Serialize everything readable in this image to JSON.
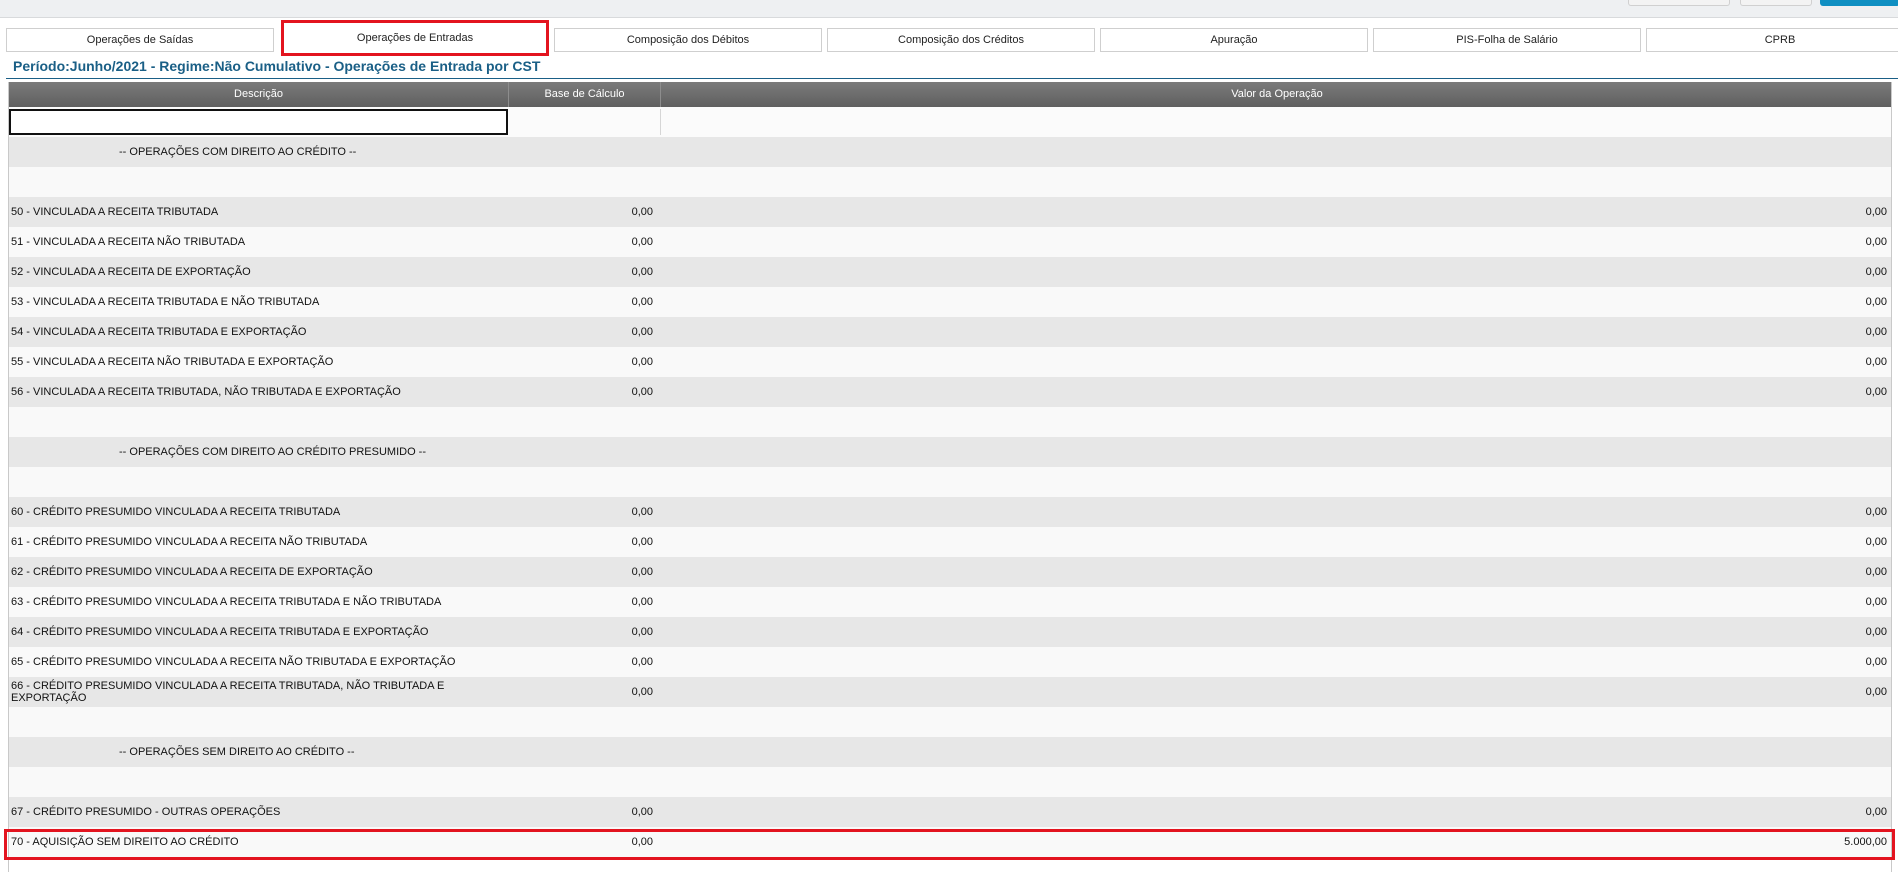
{
  "tabs": [
    {
      "label": "Operações de Saídas",
      "active": false
    },
    {
      "label": "Operações de Entradas",
      "active": true
    },
    {
      "label": "Composição dos Débitos",
      "active": false
    },
    {
      "label": "Composição dos Créditos",
      "active": false
    },
    {
      "label": "Apuração",
      "active": false
    },
    {
      "label": "PIS-Folha de Salário",
      "active": false
    },
    {
      "label": "CPRB",
      "active": false
    }
  ],
  "period_title": "Período:Junho/2021 - Regime:Não Cumulativo - Operações de Entrada por CST",
  "table": {
    "columns": [
      "Descrição",
      "Base de Cálculo",
      "Valor da Operação"
    ],
    "filter_value": "",
    "rows": [
      {
        "type": "section",
        "desc": "-- OPERAÇÕES COM DIREITO AO CRÉDITO --",
        "base": "",
        "valor": ""
      },
      {
        "type": "blank",
        "desc": "",
        "base": "",
        "valor": ""
      },
      {
        "type": "data",
        "desc": "50 - VINCULADA A RECEITA TRIBUTADA",
        "base": "0,00",
        "valor": "0,00"
      },
      {
        "type": "data",
        "desc": "51 - VINCULADA A RECEITA NÃO TRIBUTADA",
        "base": "0,00",
        "valor": "0,00"
      },
      {
        "type": "data",
        "desc": "52 - VINCULADA A RECEITA DE EXPORTAÇÃO",
        "base": "0,00",
        "valor": "0,00"
      },
      {
        "type": "data",
        "desc": "53 - VINCULADA A RECEITA TRIBUTADA E NÃO TRIBUTADA",
        "base": "0,00",
        "valor": "0,00"
      },
      {
        "type": "data",
        "desc": "54 - VINCULADA A RECEITA TRIBUTADA E EXPORTAÇÃO",
        "base": "0,00",
        "valor": "0,00"
      },
      {
        "type": "data",
        "desc": "55 - VINCULADA A RECEITA NÃO TRIBUTADA E EXPORTAÇÃO",
        "base": "0,00",
        "valor": "0,00"
      },
      {
        "type": "data",
        "desc": "56 - VINCULADA A RECEITA TRIBUTADA, NÃO TRIBUTADA E EXPORTAÇÃO",
        "base": "0,00",
        "valor": "0,00"
      },
      {
        "type": "blank",
        "desc": "",
        "base": "",
        "valor": ""
      },
      {
        "type": "section",
        "desc": "-- OPERAÇÕES COM DIREITO AO CRÉDITO PRESUMIDO --",
        "base": "",
        "valor": ""
      },
      {
        "type": "blank",
        "desc": "",
        "base": "",
        "valor": ""
      },
      {
        "type": "data",
        "desc": "60 - CRÉDITO PRESUMIDO VINCULADA A RECEITA TRIBUTADA",
        "base": "0,00",
        "valor": "0,00"
      },
      {
        "type": "data",
        "desc": "61 - CRÉDITO PRESUMIDO VINCULADA A RECEITA NÃO TRIBUTADA",
        "base": "0,00",
        "valor": "0,00"
      },
      {
        "type": "data",
        "desc": "62 - CRÉDITO PRESUMIDO VINCULADA A RECEITA DE EXPORTAÇÃO",
        "base": "0,00",
        "valor": "0,00"
      },
      {
        "type": "data",
        "desc": "63 - CRÉDITO PRESUMIDO VINCULADA A RECEITA TRIBUTADA E NÃO TRIBUTADA",
        "base": "0,00",
        "valor": "0,00"
      },
      {
        "type": "data",
        "desc": "64 - CRÉDITO PRESUMIDO VINCULADA A RECEITA TRIBUTADA E EXPORTAÇÃO",
        "base": "0,00",
        "valor": "0,00"
      },
      {
        "type": "data",
        "desc": "65 - CRÉDITO PRESUMIDO VINCULADA A RECEITA NÃO TRIBUTADA E EXPORTAÇÃO",
        "base": "0,00",
        "valor": "0,00"
      },
      {
        "type": "data",
        "desc": "66 - CRÉDITO PRESUMIDO VINCULADA A RECEITA TRIBUTADA, NÃO TRIBUTADA E EXPORTAÇÃO",
        "base": "0,00",
        "valor": "0,00"
      },
      {
        "type": "blank",
        "desc": "",
        "base": "",
        "valor": ""
      },
      {
        "type": "section",
        "desc": "-- OPERAÇÕES SEM DIREITO AO CRÉDITO --",
        "base": "",
        "valor": ""
      },
      {
        "type": "blank",
        "desc": "",
        "base": "",
        "valor": ""
      },
      {
        "type": "data",
        "desc": "67 - CRÉDITO PRESUMIDO - OUTRAS OPERAÇÕES",
        "base": "0,00",
        "valor": "0,00"
      },
      {
        "type": "data",
        "desc": "70 - AQUISIÇÃO SEM DIREITO AO CRÉDITO",
        "base": "0,00",
        "valor": "5.000,00"
      }
    ]
  },
  "colors": {
    "highlight": "#e3141f",
    "title": "#1a5f86",
    "accent": "#0f8fc2"
  }
}
